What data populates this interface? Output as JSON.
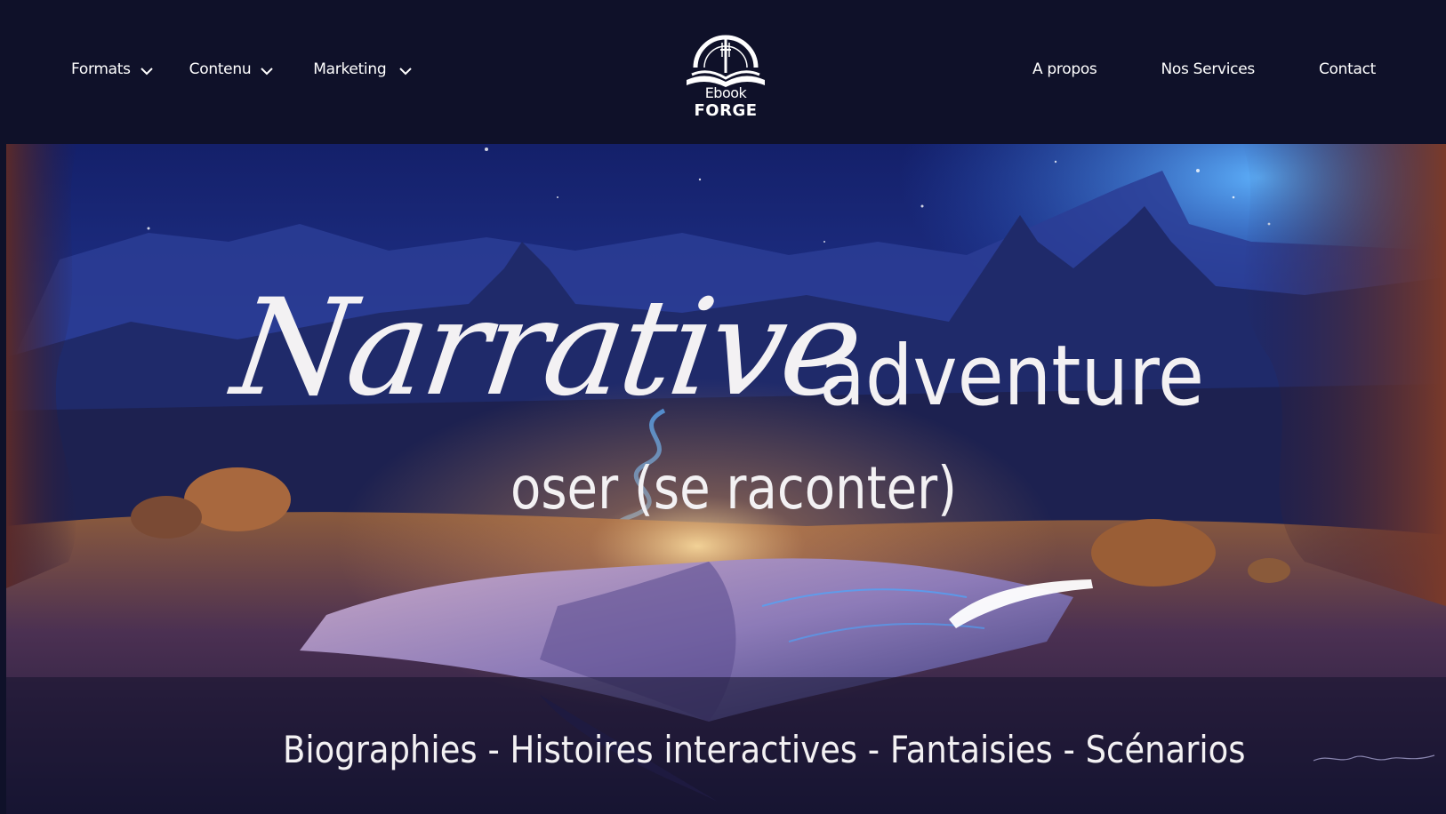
{
  "nav": {
    "left_items": [
      {
        "label": "Formats"
      },
      {
        "label": "Contenu"
      },
      {
        "label": "Marketing"
      }
    ],
    "right_items": [
      {
        "label": "A propos"
      },
      {
        "label": "Nos Services"
      },
      {
        "label": "Contact"
      }
    ]
  },
  "logo": {
    "line1": "Ebook",
    "line2": "FORGE"
  },
  "hero": {
    "headline_script": "Narrative",
    "headline_word": "adventure",
    "subheadline": "oser (se raconter)",
    "tagline": "Biographies - Histoires interactives - Fantaisies - Scénarios"
  },
  "colors": {
    "nav_background": "#0f1129",
    "text": "#f3f1f3",
    "sky_top": "#1b2a7a",
    "sky_glow": "#3a8bf0",
    "ground_warm": "#c27a3e"
  }
}
